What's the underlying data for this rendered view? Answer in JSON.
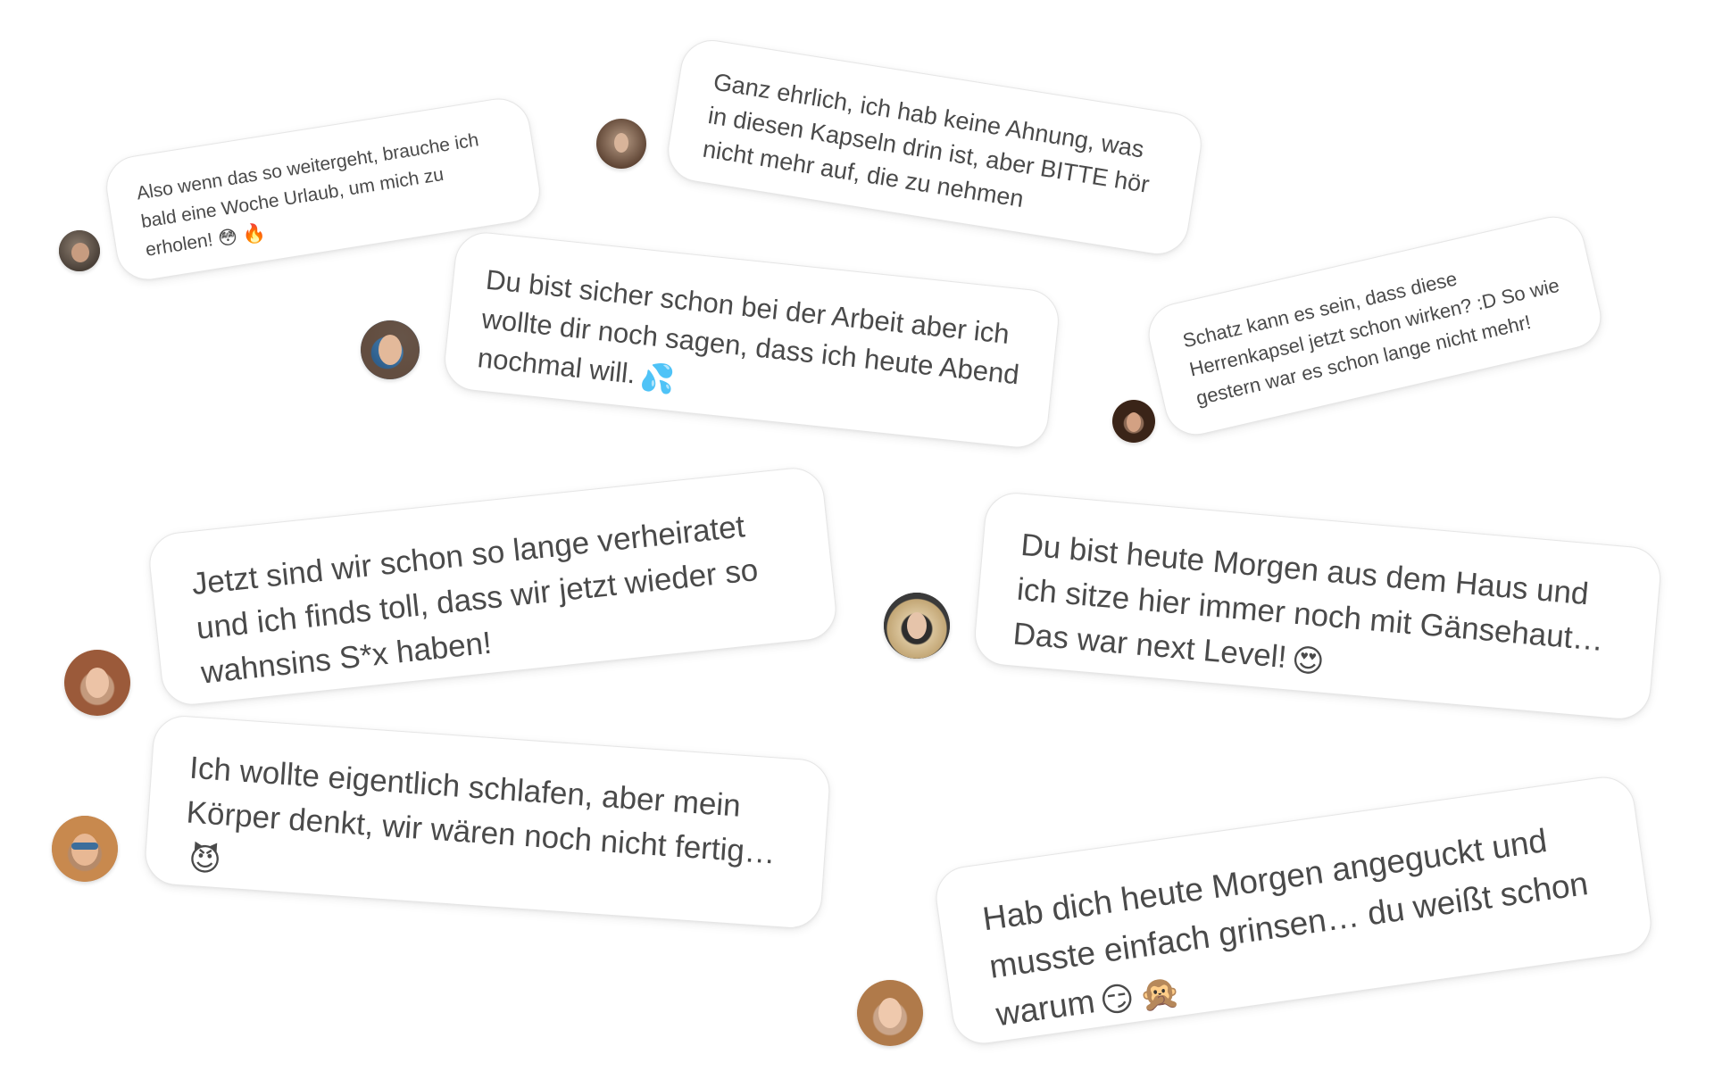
{
  "messages": [
    {
      "text": "Also wenn das so weitergeht, brauche ich bald eine Woche Urlaub, um mich zu erholen!",
      "emojis": [
        "😳",
        "🔥"
      ]
    },
    {
      "text": "Ganz ehrlich, ich hab keine Ahnung, was in diesen Kapseln drin ist, aber BITTE hör nicht mehr auf, die zu nehmen",
      "emojis": []
    },
    {
      "text": "Du bist sicher schon bei der Arbeit aber ich wollte dir noch sagen, dass ich heute Abend nochmal will.",
      "emojis": [
        "💦"
      ]
    },
    {
      "text": "Schatz kann es sein, dass diese Herrenkapsel jetzt schon wirken? :D So wie gestern war es schon lange nicht mehr!",
      "emojis": []
    },
    {
      "text": "Jetzt sind wir schon so lange verheiratet und ich finds toll, dass wir jetzt wieder so wahnsins S*x haben!",
      "emojis": []
    },
    {
      "text": "Du bist heute Morgen aus dem Haus und ich sitze hier immer noch mit Gänsehaut… Das war next Level!",
      "emojis": [
        "😍"
      ]
    },
    {
      "text": "Ich wollte eigentlich schlafen, aber mein Körper denkt, wir wären noch nicht fertig…",
      "emojis": [
        "😈"
      ]
    },
    {
      "text": "Hab dich heute Morgen angeguckt und musste einfach grinsen… du weißt schon warum",
      "emojis": [
        "😏",
        "🙊"
      ]
    }
  ]
}
